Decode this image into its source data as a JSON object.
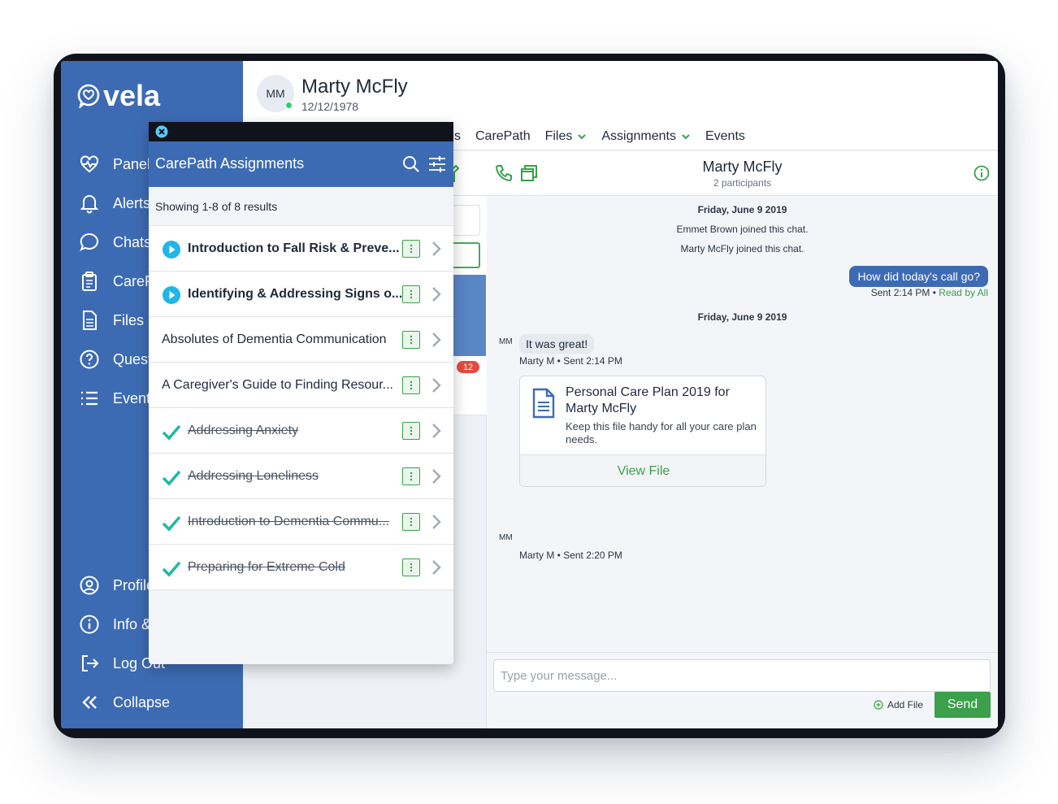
{
  "brand": {
    "name": "vela"
  },
  "sidebar": {
    "items": [
      {
        "label": "Panel",
        "icon": "heart-pulse-icon"
      },
      {
        "label": "Alerts",
        "icon": "bell-icon"
      },
      {
        "label": "Chats",
        "icon": "chat-icon"
      },
      {
        "label": "CarePath",
        "icon": "clipboard-icon"
      },
      {
        "label": "Files",
        "icon": "file-icon"
      },
      {
        "label": "Questions",
        "icon": "question-icon"
      },
      {
        "label": "Events",
        "icon": "list-icon"
      }
    ],
    "bottom": [
      {
        "label": "Profile",
        "icon": "user-circle-icon"
      },
      {
        "label": "Info & Help",
        "icon": "info-icon"
      },
      {
        "label": "Log Out",
        "icon": "logout-icon"
      },
      {
        "label": "Collapse",
        "icon": "chevrons-left-icon"
      }
    ]
  },
  "patient": {
    "initials": "MM",
    "name": "Marty McFly",
    "dob": "12/12/1978"
  },
  "tabs": [
    {
      "label": "s",
      "dropdown": false
    },
    {
      "label": "CarePath",
      "dropdown": false
    },
    {
      "label": "Files",
      "dropdown": true
    },
    {
      "label": "Assignments",
      "dropdown": true
    },
    {
      "label": "Events",
      "dropdown": false
    }
  ],
  "list_pane": {
    "unread_badge": "12"
  },
  "popover": {
    "title": "CarePath Assignments",
    "count_text": "Showing 1-8 of 8 results",
    "rows": [
      {
        "label": "Introduction to Fall Risk & Preve...",
        "status": "in-progress"
      },
      {
        "label": "Identifying & Addressing Signs o...",
        "status": "in-progress"
      },
      {
        "label": "Absolutes of Dementia Communication",
        "status": "none"
      },
      {
        "label": "A Caregiver's Guide to Finding Resour...",
        "status": "none"
      },
      {
        "label": "Addressing Anxiety",
        "status": "complete"
      },
      {
        "label": "Addressing Loneliness",
        "status": "complete"
      },
      {
        "label": "Introduction to Dementia Commu...",
        "status": "complete"
      },
      {
        "label": "Preparing for Extreme Cold",
        "status": "complete"
      }
    ]
  },
  "chat": {
    "title": "Marty McFly",
    "participants": "2 participants",
    "day1": "Friday, June 9 2019",
    "join1": "Emmet Brown joined this chat.",
    "join2": "Marty McFly joined this chat.",
    "out_msg": "How did today's call go?",
    "out_sent": "Sent 2:14 PM •",
    "out_read": "Read by All",
    "day2": "Friday, June 9 2019",
    "sender_initials": "MM",
    "in_msg": "It was great!",
    "in_meta": "Marty M • Sent 2:14 PM",
    "file_title": "Personal Care Plan 2019 for Marty McFly",
    "file_desc": "Keep this file handy for all your care plan needs.",
    "file_action": "View File",
    "file_meta": "Marty M • Sent 2:20 PM",
    "input_placeholder": "Type your message...",
    "add_file": "Add File",
    "send": "Send"
  },
  "colors": {
    "primary": "#3d6bb3",
    "accent_green": "#3aa049",
    "teal_check": "#22b8a2",
    "play_cyan": "#21b5e8",
    "badge_red": "#e54b3c",
    "device": "#10131c"
  }
}
